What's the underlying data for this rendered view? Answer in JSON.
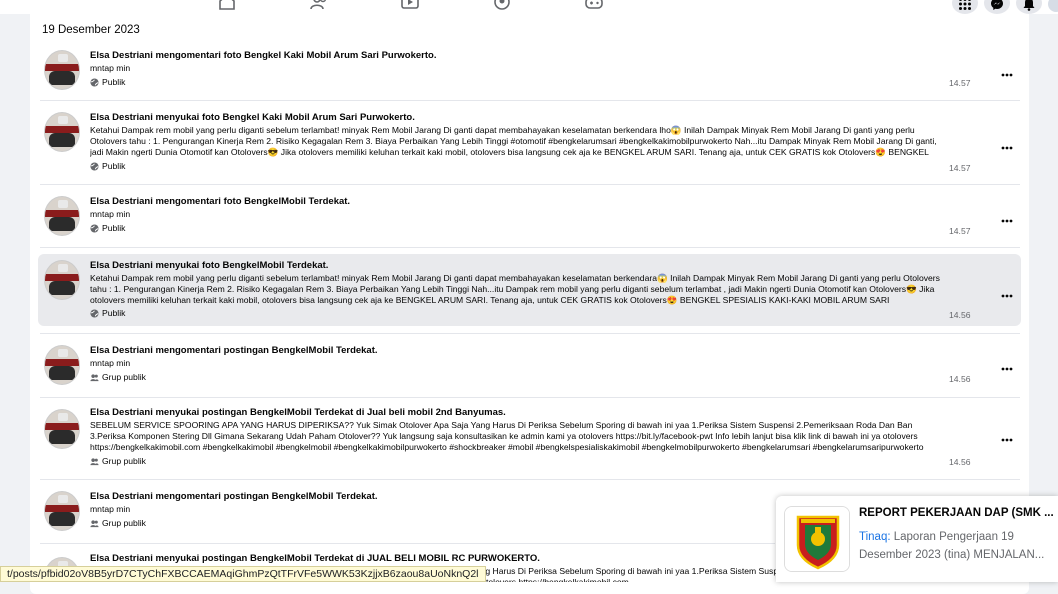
{
  "nav": {
    "items": [
      "home-icon",
      "friends-icon",
      "video-icon",
      "groups-icon",
      "gaming-icon"
    ],
    "right": [
      "menu-grid-icon",
      "messenger-icon",
      "bell-icon"
    ]
  },
  "date_heading": "19 Desember 2023",
  "entries": [
    {
      "title": "Elsa Destriani mengomentari foto Bengkel Kaki Mobil Arum Sari Purwokerto.",
      "sub": "mntap min",
      "body": "",
      "audience": "Publik",
      "time": "14.57"
    },
    {
      "title": "Elsa Destriani menyukai foto Bengkel Kaki Mobil Arum Sari Purwokerto.",
      "sub": "",
      "body": "Ketahui Dampak rem mobil yang perlu diganti sebelum terlambat! minyak Rem Mobil Jarang Di ganti dapat membahayakan keselamatan berkendara lho😱 Inilah Dampak Minyak Rem Mobil Jarang Di ganti yang perlu Otolovers tahu : 1. Pengurangan Kinerja Rem 2. Risiko Kegagalan Rem 3. Biaya Perbaikan Yang Lebih Tinggi #otomotif #bengkelarumsari #bengkelkakimobilpurwokerto Nah...itu Dampak Minyak Rem Mobil Jarang Di ganti, jadi Makin ngerti Dunia Otomotif kan Otolovers😎 Jika otolovers memiliki keluhan terkait kaki mobil, otolovers bisa langsung cek aja ke BENGKEL ARUM SARI. Tenang aja, untuk CEK GRATIS kok Otolovers😍 BENGKEL SPESIALIS KAKI-KAKI MOBIL...",
      "audience": "Publik",
      "time": "14.57"
    },
    {
      "title": "Elsa Destriani mengomentari foto BengkelMobil Terdekat.",
      "sub": "mntap min",
      "body": "",
      "audience": "Publik",
      "time": "14.57"
    },
    {
      "title": "Elsa Destriani menyukai foto BengkelMobil Terdekat.",
      "sub": "",
      "body": "Ketahui Dampak rem mobil yang perlu diganti sebelum terlambat! minyak Rem Mobil Jarang Di ganti dapat membahayakan keselamatan berkendara😱 Inilah Dampak Minyak Rem Mobil Jarang Di ganti yang perlu Otolovers tahu : 1. Pengurangan Kinerja Rem 2. Risiko Kegagalan Rem 3. Biaya Perbaikan Yang Lebih Tinggi Nah...itu Dampak rem mobil yang perlu diganti sebelum terlambat , jadi Makin ngerti Dunia Otomotif kan Otolovers😎 Jika otolovers memiliki keluhan terkait kaki mobil, otolovers bisa langsung cek aja ke BENGKEL ARUM SARI. Tenang aja, untuk CEK GRATIS kok Otolovers😍 BENGKEL SPESIALIS KAKI-KAKI MOBIL ARUM SARI PURWOKERTO Yuk langsung bookin...",
      "audience": "Publik",
      "time": "14.56"
    },
    {
      "title": "Elsa Destriani mengomentari postingan BengkelMobil Terdekat.",
      "sub": "mntap min",
      "body": "",
      "audience": "Grup publik",
      "time": "14.56"
    },
    {
      "title": "Elsa Destriani menyukai postingan BengkelMobil Terdekat di Jual beli mobil 2nd Banyumas.",
      "sub": "",
      "body": "SEBELUM SERVICE SPOORING APA YANG HARUS DIPERIKSA?? Yuk Simak Otolover Apa Saja Yang Harus Di Periksa Sebelum Sporing di bawah ini yaa 1.Periksa Sistem Suspensi 2.Pemeriksaan Roda Dan Ban 3.Periksa Komponen Stering Dll Gimana Sekarang Udah Paham Otolover?? Yuk langsung saja konsultasikan ke admin kami ya otolovers https://bit.ly/facebook-pwt Info lebih lanjut bisa klik link di bawah ini ya otolovers https://bengkelkakimobil.com #bengkelkakimobil #bengkelmobil #bengkelkakimobilpurwokerto #shockbreaker #mobil #bengkelspesialiskakimobil #bengkelmobilpurwokerto #bengkelarumsari #bengkelarumsaripurwokerto",
      "audience": "Grup publik",
      "time": "14.56"
    },
    {
      "title": "Elsa Destriani mengomentari postingan BengkelMobil Terdekat.",
      "sub": "mntap min",
      "body": "",
      "audience": "Grup publik",
      "time": ""
    },
    {
      "title": "Elsa Destriani menyukai postingan BengkelMobil Terdekat di JUAL BELI MOBIL RC PURWOKERTO.",
      "sub": "",
      "body": "SEBELUM SERVICE SPOORING APA YANG HARUS DIPERIKSA?? Yuk Simak Otolover Apa Saja Yang Harus Di Periksa Sebelum Sporing di bawah ini yaa 1.Periksa Sistem Suspensi 2.Pemeriksaan Roda Dan Ban 3.Periksa Komponen Stering Dll https://bit.ly/facebook-pwt Info lebih lanjut bisa klik link di bawah ini ya otolovers https://bengkelkakimobil.com",
      "audience": "",
      "time": ""
    }
  ],
  "notification": {
    "title": "REPORT PEKERJAAN DAP (SMK ...",
    "sender": "Tinaq:",
    "line1": " Laporan Pengerjaan 19",
    "line2": "Desember 2023 (tina) MENJALAN..."
  },
  "status_url": "t/posts/pfbid02oV8B5yrD7CTyChFXBCCAEMAqiGhmPzQtTFrVFe5WWK53KzjjxB6zaou8aUoNknQ2l",
  "colors": {
    "page_bg": "#f0f2f5",
    "card_bg": "#ffffff",
    "highlight_bg": "#e9eaed",
    "secondary_text": "#65676b",
    "link_blue": "#1b74e4",
    "status_bg": "#fffbd6"
  }
}
